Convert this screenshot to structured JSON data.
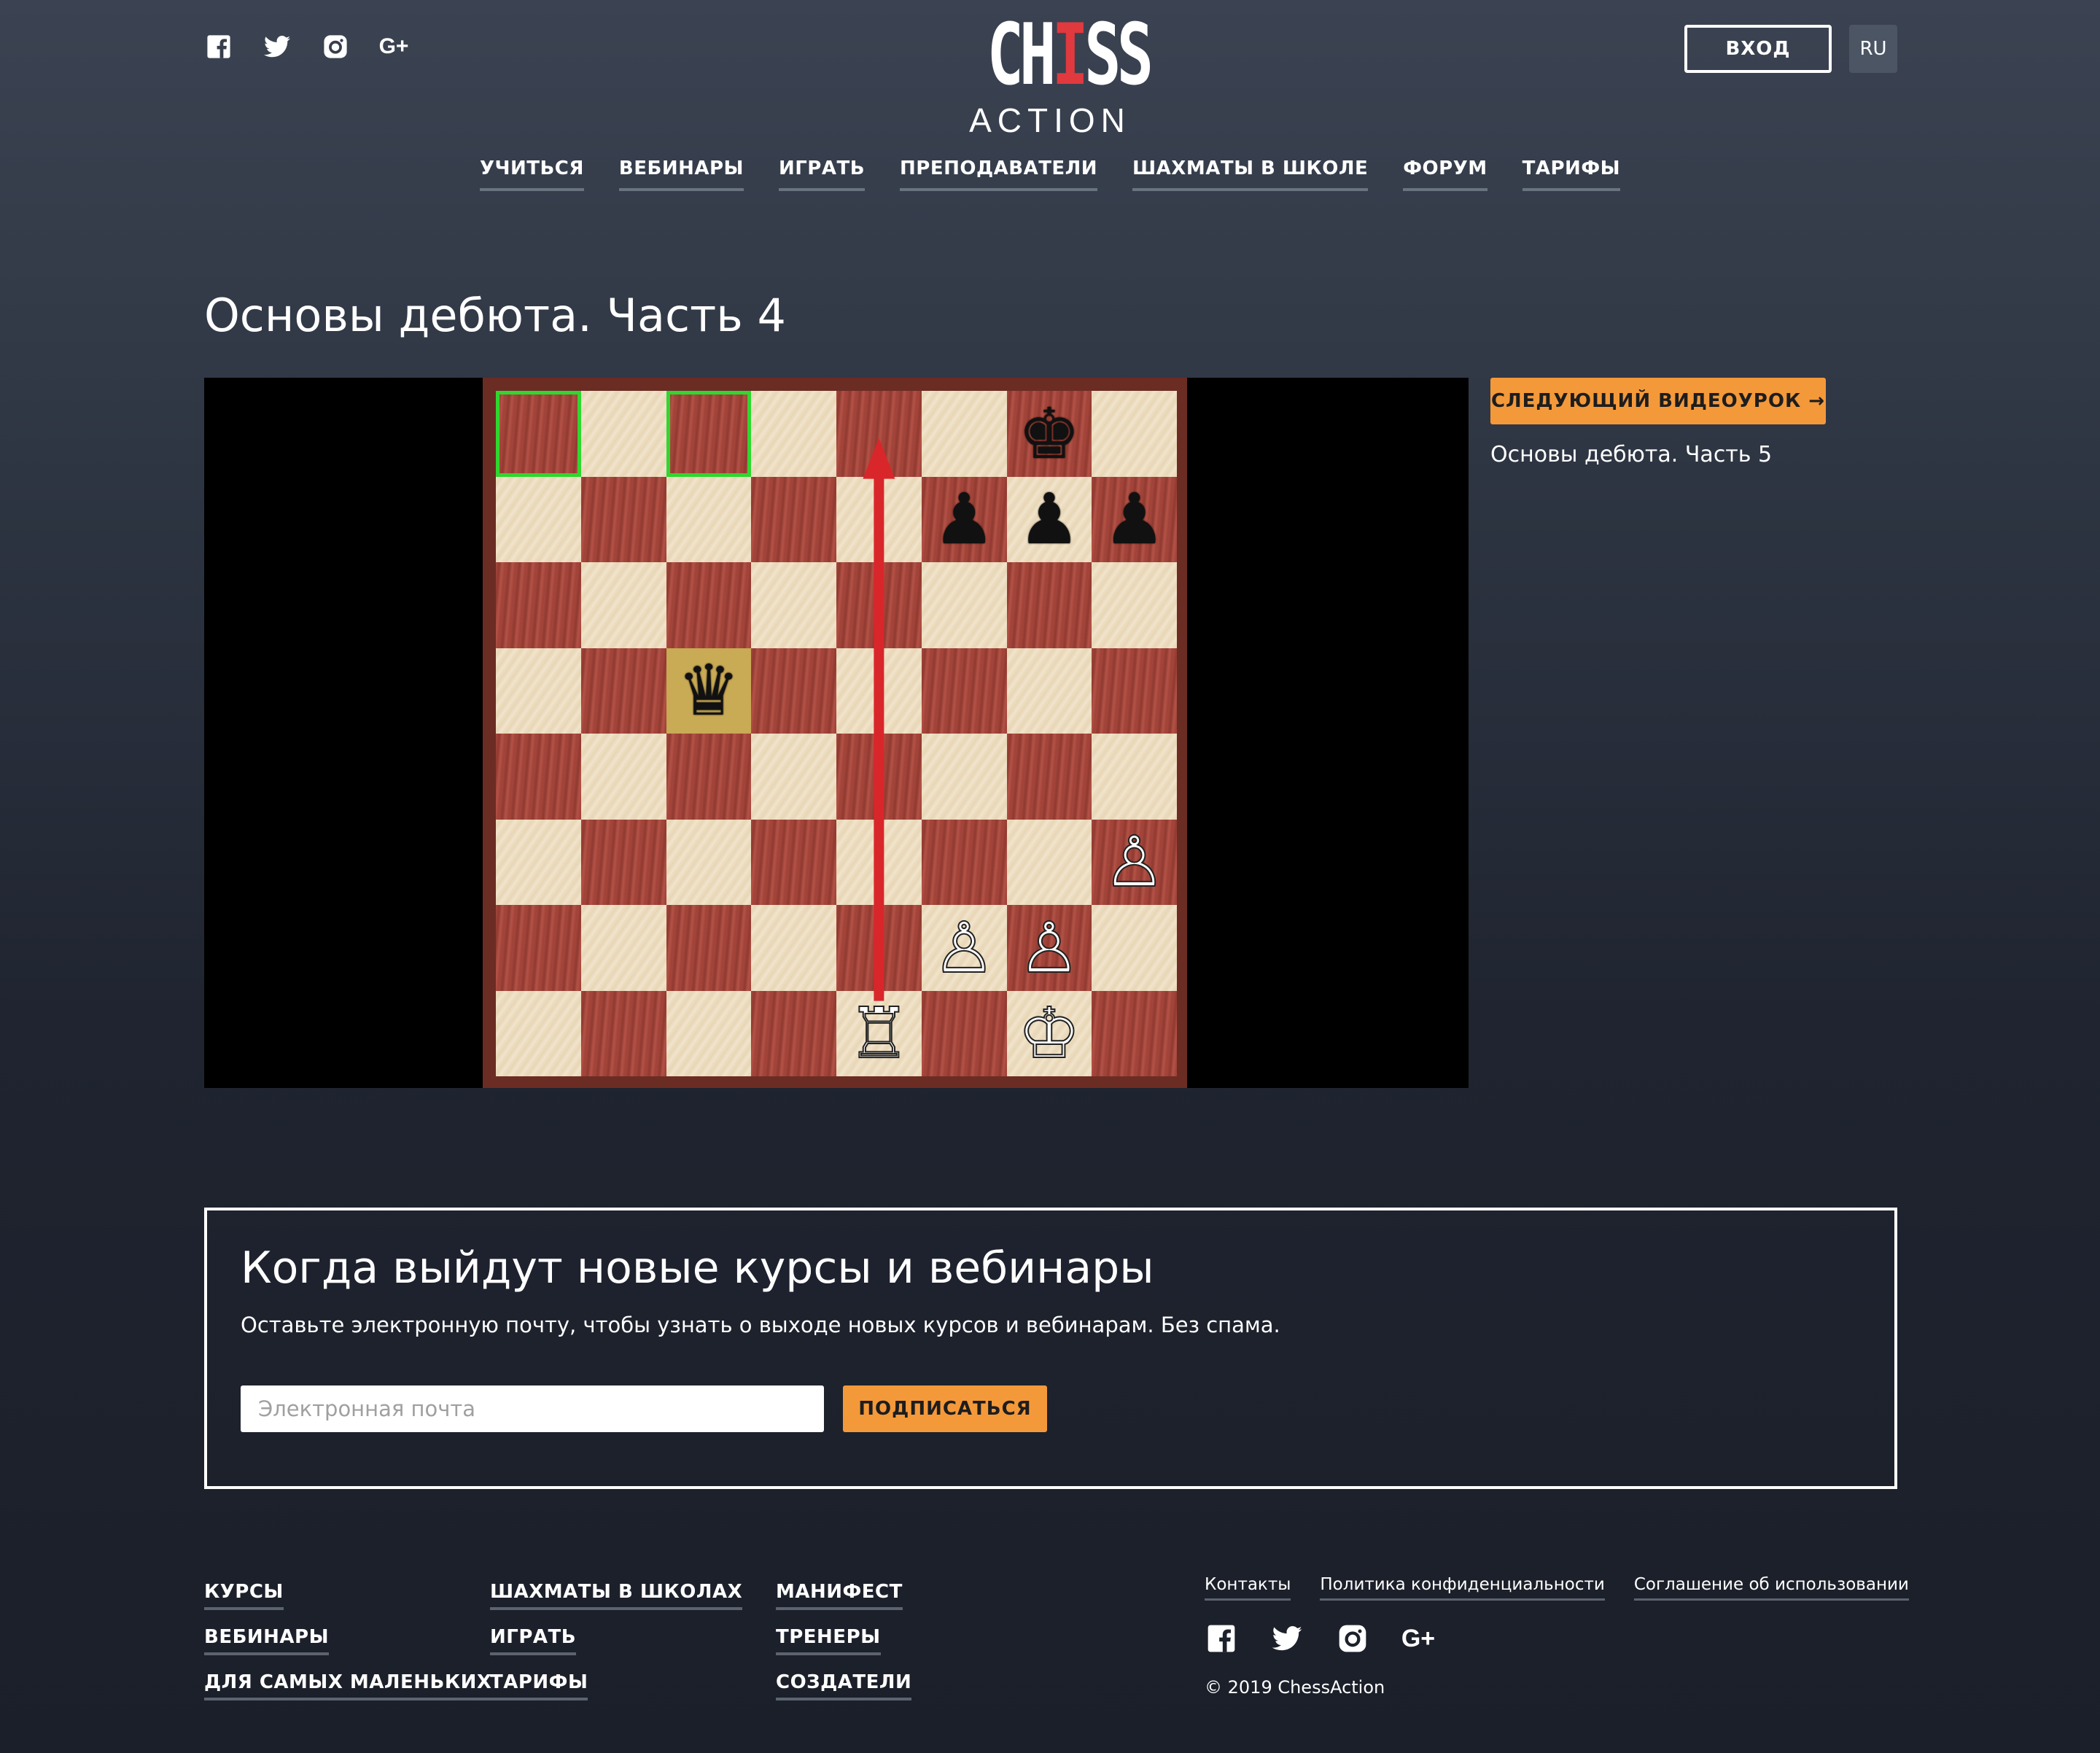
{
  "header": {
    "social": [
      {
        "name": "facebook-icon",
        "glyph": "f"
      },
      {
        "name": "twitter-icon",
        "glyph": "t"
      },
      {
        "name": "instagram-icon",
        "glyph": "i"
      },
      {
        "name": "google-plus-icon",
        "glyph": "G+"
      }
    ],
    "logo": {
      "line1_a": "CH",
      "line1_b": "I",
      "line1_c": "SS",
      "line2": "ACTION"
    },
    "login_label": "ВХОД",
    "lang_label": "RU"
  },
  "nav": [
    "УЧИТЬСЯ",
    "ВЕБИНАРЫ",
    "ИГРАТЬ",
    "ПРЕПОДАВАТЕЛИ",
    "ШАХМАТЫ В ШКОЛЕ",
    "ФОРУМ",
    "ТАРИФЫ"
  ],
  "lesson": {
    "title": "Основы дебюта. Часть 4",
    "next_button": "СЛЕДУЮЩИЙ ВИДЕОУРОК →",
    "next_title": "Основы дебюта. Часть 5"
  },
  "board": {
    "highlighted_squares": [
      "a8",
      "c8"
    ],
    "pieces": {
      "g8": "♚",
      "f7": "♟",
      "g7": "♟",
      "h7": "♟",
      "c5": "♛",
      "h3": "♙",
      "f2": "♙",
      "g2": "♙",
      "e1": "♖",
      "g1": "♔"
    },
    "arrow": {
      "from": "e1",
      "to": "e8",
      "color": "#d9262b"
    }
  },
  "subscribe": {
    "heading": "Когда выйдут новые курсы и вебинары",
    "text": "Оставьте электронную почту, чтобы узнать о выходе новых курсов и вебинарам. Без спама.",
    "email_placeholder": "Электронная почта",
    "button": "ПОДПИСАТЬСЯ"
  },
  "footer": {
    "col1": [
      "КУРСЫ",
      "ВЕБИНАРЫ",
      "ДЛЯ САМЫХ МАЛЕНЬКИХ"
    ],
    "col2": [
      "ШАХМАТЫ В ШКОЛАХ",
      "ИГРАТЬ",
      "ТАРИФЫ"
    ],
    "col3": [
      "МАНИФЕСТ",
      "ТРЕНЕРЫ",
      "СОЗДАТЕЛИ"
    ],
    "legal": [
      "Контакты",
      "Политика конфиденциальности",
      "Соглашение об использовании"
    ],
    "copyright": "© 2019 ChessAction"
  },
  "colors": {
    "accent": "#f4993a",
    "highlight": "#2fd72f",
    "arrow": "#d9262b"
  }
}
